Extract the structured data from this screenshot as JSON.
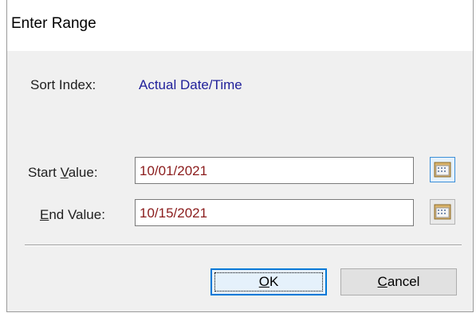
{
  "window": {
    "title": "Enter Range"
  },
  "sort_index": {
    "label": "Sort Index:",
    "value": "Actual Date/Time"
  },
  "start": {
    "label_pre": "Start ",
    "label_ul": "V",
    "label_post": "alue:",
    "value": "10/01/2021"
  },
  "end": {
    "label_ul": "E",
    "label_post": "nd Value:",
    "value": "10/15/2021"
  },
  "buttons": {
    "ok": {
      "ul": "O",
      "rest": "K"
    },
    "cancel": {
      "ul": "C",
      "rest": "ancel"
    }
  },
  "icons": {
    "calendar": "calendar-icon"
  },
  "colors": {
    "value_text": "#8b1c1c",
    "index_text": "#1f1f9a",
    "accent": "#0078d7"
  }
}
